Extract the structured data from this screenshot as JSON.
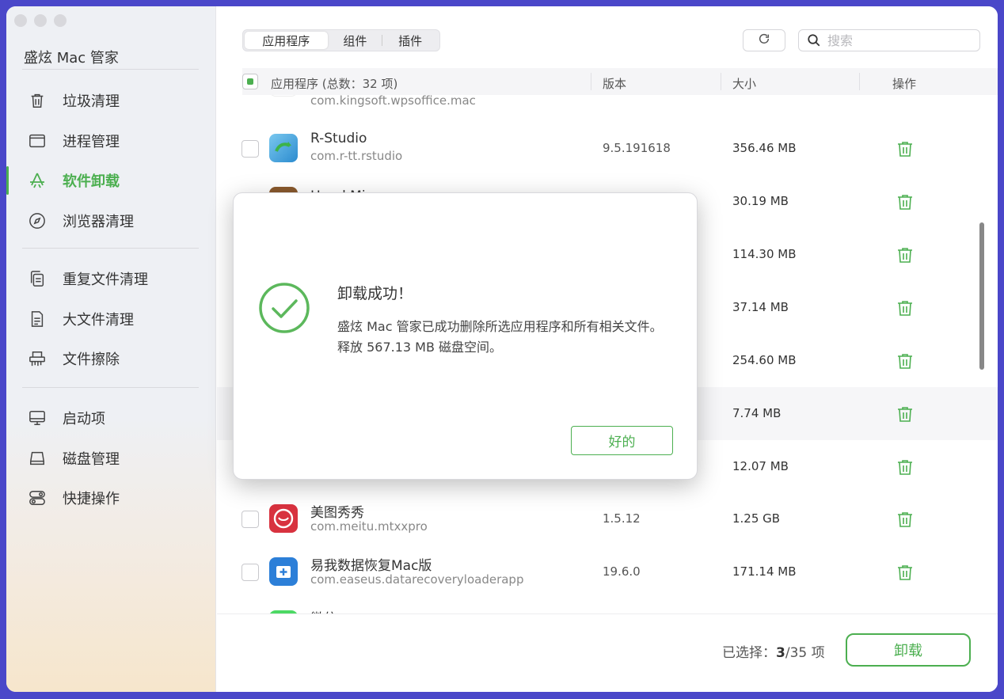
{
  "app": {
    "title": "盛炫 Mac 管家"
  },
  "sidebar": {
    "items": [
      {
        "label": "垃圾清理",
        "icon": "trash-icon"
      },
      {
        "label": "进程管理",
        "icon": "window-icon"
      },
      {
        "label": "软件卸载",
        "icon": "app-store-icon"
      },
      {
        "label": "浏览器清理",
        "icon": "compass-icon"
      },
      {
        "label": "重复文件清理",
        "icon": "duplicate-files-icon"
      },
      {
        "label": "大文件清理",
        "icon": "document-icon"
      },
      {
        "label": "文件擦除",
        "icon": "shredder-icon"
      },
      {
        "label": "启动项",
        "icon": "monitor-icon"
      },
      {
        "label": "磁盘管理",
        "icon": "disk-icon"
      },
      {
        "label": "快捷操作",
        "icon": "toggle-icon"
      }
    ],
    "active": "软件卸载"
  },
  "toolbar": {
    "tabs": [
      "应用程序",
      "组件",
      "插件"
    ],
    "active_tab": "应用程序",
    "search_placeholder": "搜索"
  },
  "table": {
    "headers": {
      "name": "应用程序 (总数：32 项)",
      "version": "版本",
      "size": "大小",
      "action": "操作"
    },
    "rows": [
      {
        "name": "",
        "bundle": "com.kingsoft.wpsoffice.mac",
        "version": "",
        "size": "",
        "checked": false,
        "icon_color": "#e04a3a"
      },
      {
        "name": "R-Studio",
        "bundle": "com.r-tt.rstudio",
        "version": "9.5.191618",
        "size": "356.46 MB",
        "checked": false,
        "icon_color": "#3aa0d8"
      },
      {
        "name": "Hand Mirror",
        "bundle": "",
        "version": "",
        "size": "30.19 MB",
        "checked": true,
        "icon_color": "#8a5a2e"
      },
      {
        "name": "",
        "bundle": "",
        "version": "",
        "size": "114.30 MB",
        "checked": false,
        "icon_color": ""
      },
      {
        "name": "",
        "bundle": "",
        "version": "",
        "size": "37.14 MB",
        "checked": false,
        "icon_color": ""
      },
      {
        "name": "",
        "bundle": "",
        "version": "",
        "size": "254.60 MB",
        "checked": false,
        "icon_color": ""
      },
      {
        "name": "",
        "bundle": "",
        "version": "",
        "size": "7.74 MB",
        "checked": false,
        "icon_color": ""
      },
      {
        "name": "",
        "bundle": "",
        "version": "",
        "size": "12.07 MB",
        "checked": false,
        "icon_color": ""
      },
      {
        "name": "美图秀秀",
        "bundle": "com.meitu.mtxxpro",
        "version": "1.5.12",
        "size": "1.25 GB",
        "checked": false,
        "icon_color": "#d8323f"
      },
      {
        "name": "易我数据恢复Mac版",
        "bundle": "com.easeus.datarecoveryloaderapp",
        "version": "19.6.0",
        "size": "171.14 MB",
        "checked": false,
        "icon_color": "#2c7fd8"
      },
      {
        "name": "微信",
        "bundle": "",
        "version": "",
        "size": "",
        "checked": false,
        "icon_color": "#4cd964"
      }
    ]
  },
  "footer": {
    "selected_prefix": "已选择：",
    "selected_count": "3",
    "selected_suffix": "/35 项",
    "uninstall_label": "卸载"
  },
  "dialog": {
    "title": "卸载成功！",
    "message": "盛炫 Mac 管家已成功删除所选应用程序和所有相关文件。释放 567.13 MB 磁盘空间。",
    "ok_label": "好的"
  },
  "colors": {
    "accent": "#4caf50",
    "background": "#4a47c9"
  }
}
